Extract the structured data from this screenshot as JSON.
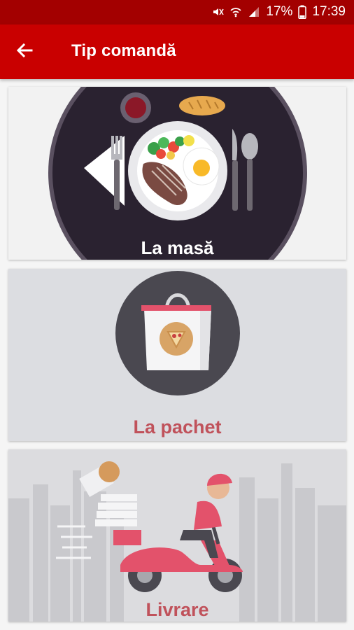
{
  "status_bar": {
    "battery_percent": "17%",
    "time": "17:39",
    "icons": [
      "mute-icon",
      "wifi-icon",
      "signal-icon",
      "battery-icon"
    ]
  },
  "app_bar": {
    "back_icon": "arrow-left-icon",
    "title": "Tip comandă"
  },
  "order_types": [
    {
      "label": "La masă",
      "image": "plate-with-cutlery"
    },
    {
      "label": "La pachet",
      "image": "takeaway-bag-with-pizza"
    },
    {
      "label": "Livrare",
      "image": "delivery-scooter-courier"
    }
  ],
  "colors": {
    "status_bar": "#a30000",
    "app_bar": "#c90000",
    "label_accent": "#c0525b"
  }
}
